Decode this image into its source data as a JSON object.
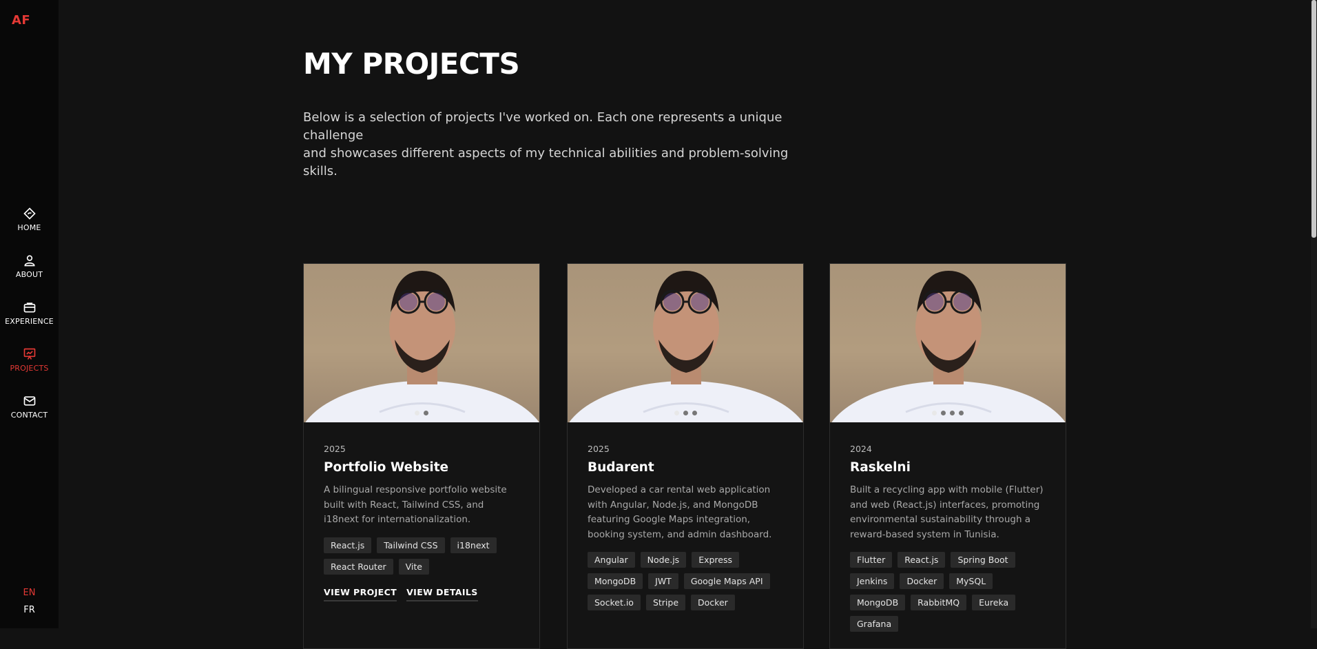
{
  "brand": {
    "logo": "AF",
    "accent_color": "#e53935"
  },
  "nav": {
    "items": [
      {
        "label": "HOME",
        "icon": "home-icon",
        "active": false
      },
      {
        "label": "ABOUT",
        "icon": "user-icon",
        "active": false
      },
      {
        "label": "EXPERIENCE",
        "icon": "briefcase-icon",
        "active": false
      },
      {
        "label": "PROJECTS",
        "icon": "presentation-icon",
        "active": true
      },
      {
        "label": "CONTACT",
        "icon": "mail-icon",
        "active": false
      }
    ]
  },
  "languages": {
    "en": "EN",
    "fr": "FR",
    "active": "EN"
  },
  "main": {
    "title": "MY PROJECTS",
    "intro_line1": "Below is a selection of projects I've worked on. Each one represents a unique challenge",
    "intro_line2": "and showcases different aspects of my technical abilities and problem-solving skills."
  },
  "projects": [
    {
      "year": "2025",
      "title": "Portfolio Website",
      "description": "A bilingual responsive portfolio website built with React, Tailwind CSS, and i18next for internationalization.",
      "tags": [
        "React.js",
        "Tailwind CSS",
        "i18next",
        "React Router",
        "Vite"
      ],
      "image_count": 2,
      "view_project": "VIEW PROJECT",
      "view_details": "VIEW DETAILS"
    },
    {
      "year": "2025",
      "title": "Budarent",
      "description": "Developed a car rental web application with Angular, Node.js, and MongoDB featuring Google Maps integration, booking system, and admin dashboard.",
      "tags": [
        "Angular",
        "Node.js",
        "Express",
        "MongoDB",
        "JWT",
        "Google Maps API",
        "Socket.io",
        "Stripe",
        "Docker"
      ],
      "image_count": 3
    },
    {
      "year": "2024",
      "title": "Raskelni",
      "description": "Built a recycling app with mobile (Flutter) and web (React.js) interfaces, promoting environmental sustainability through a reward-based system in Tunisia.",
      "tags": [
        "Flutter",
        "React.js",
        "Spring Boot",
        "Jenkins",
        "Docker",
        "MySQL",
        "MongoDB",
        "RabbitMQ",
        "Eureka",
        "Grafana"
      ],
      "image_count": 4
    }
  ]
}
